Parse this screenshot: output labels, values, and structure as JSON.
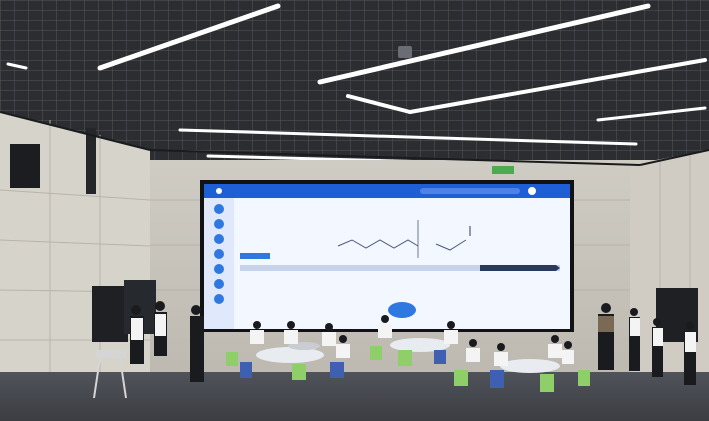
{
  "screen": {
    "header_logo": "",
    "header_title": "",
    "content_heading": "",
    "footer_caption": ""
  },
  "colors": {
    "ceiling": "#2e2f31",
    "wall": "#d9d6cf",
    "screen_header": "#1f5fd6",
    "screen_body": "#f3f7ff",
    "floor": "#4a4d53",
    "chair_green": "#8fcf6a",
    "chair_blue": "#3f5fb0"
  },
  "icons": [
    "ceiling-light-icon",
    "speaker-icon",
    "smartboard-icon",
    "camera-icon"
  ]
}
